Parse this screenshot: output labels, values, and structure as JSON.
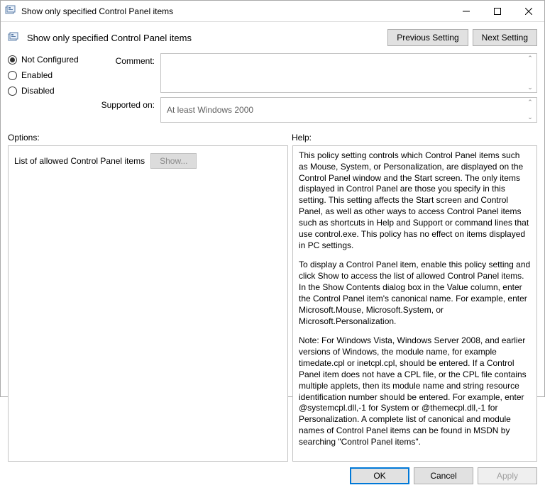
{
  "window": {
    "title": "Show only specified Control Panel items"
  },
  "header": {
    "policy_title": "Show only specified Control Panel items"
  },
  "nav": {
    "previous": "Previous Setting",
    "next": "Next Setting"
  },
  "state": {
    "selected": "Not Configured",
    "options": {
      "not_configured": "Not Configured",
      "enabled": "Enabled",
      "disabled": "Disabled"
    }
  },
  "labels": {
    "comment": "Comment:",
    "supported": "Supported on:",
    "options": "Options:",
    "help": "Help:"
  },
  "supported": {
    "text": "At least Windows 2000"
  },
  "options_pane": {
    "item_label": "List of allowed Control Panel items",
    "show_button": "Show..."
  },
  "help": {
    "p1": "This policy setting controls which Control Panel items such as Mouse, System, or Personalization, are displayed on the Control Panel window and the Start screen. The only items displayed in Control Panel are those you specify in this setting. This setting affects the Start screen and Control Panel, as well as other ways to access Control Panel items such as shortcuts in Help and Support or command lines that use control.exe. This policy has no effect on items displayed in PC settings.",
    "p2": "To display a Control Panel item, enable this policy setting and click Show to access the list of allowed Control Panel items. In the Show Contents dialog box in the Value column, enter the Control Panel item's canonical name. For example, enter Microsoft.Mouse, Microsoft.System, or Microsoft.Personalization.",
    "p3": "Note: For Windows Vista, Windows Server 2008, and earlier versions of Windows, the module name, for example timedate.cpl or inetcpl.cpl, should be entered. If a Control Panel item does not have a CPL file, or the CPL file contains multiple applets, then its module name and string resource identification number should be entered. For example, enter @systemcpl.dll,-1 for System or @themecpl.dll,-1 for Personalization. A complete list of canonical and module names of Control Panel items can be found in MSDN by searching \"Control Panel items\"."
  },
  "footer": {
    "ok": "OK",
    "cancel": "Cancel",
    "apply": "Apply"
  }
}
